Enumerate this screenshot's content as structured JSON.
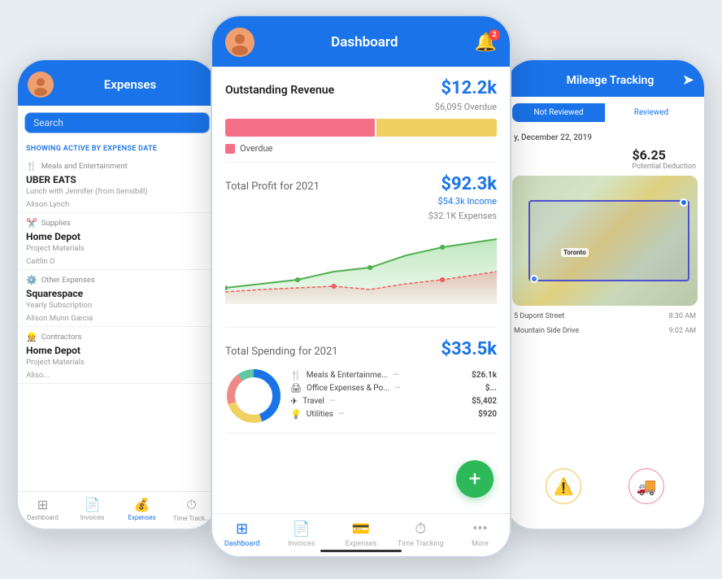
{
  "left_phone": {
    "header_title": "Expenses",
    "search_placeholder": "Search",
    "showing_label": "SHOWING",
    "showing_filter": "ACTIVE BY EXPENSE DATE",
    "groups": [
      {
        "category_icon": "🍴",
        "category": "Meals and Entertainment",
        "name": "UBER EATS",
        "sub1": "Lunch with Jennifer (from Sensibill)",
        "sub2": "Alison Lynch"
      },
      {
        "category_icon": "✂️",
        "category": "Supplies",
        "name": "Home Depot",
        "sub1": "Project Materials",
        "sub2": "Caitlin O"
      },
      {
        "category_icon": "⚙️",
        "category": "Other Expenses",
        "name": "Squarespace",
        "sub1": "Yearly Subscription",
        "sub2": "Alison Munn Garcia"
      },
      {
        "category_icon": "👷",
        "category": "Contractors",
        "name": "Home Depot",
        "sub1": "Project Materials",
        "sub2": "Aliso..."
      }
    ],
    "nav_items": [
      {
        "label": "Dashboard",
        "icon": "⊞"
      },
      {
        "label": "Invoices",
        "icon": "📄"
      },
      {
        "label": "Expenses",
        "icon": "💰",
        "active": true
      },
      {
        "label": "Time Track...",
        "icon": "⏱"
      }
    ]
  },
  "center_phone": {
    "header_title": "Dashboard",
    "notification_count": "2",
    "outstanding_revenue": {
      "title": "Outstanding Revenue",
      "amount": "$12.2k",
      "overdue_label": "$6,095 Overdue",
      "legend_label": "Overdue",
      "bar_pink_pct": 55,
      "bar_yellow_pct": 45
    },
    "total_profit": {
      "title": "Total Profit",
      "year": "for 2021",
      "amount": "$92.3k",
      "income": "$54.3k Income",
      "expenses": "$32.1K Expenses"
    },
    "total_spending": {
      "title": "Total Spending",
      "year": "for 2021",
      "amount": "$33.5k",
      "items": [
        {
          "icon": "🍴",
          "label": "Meals & Entertainme...",
          "amount": "$26.1k"
        },
        {
          "icon": "🖨",
          "label": "Office Expenses & Po...",
          "amount": "$..."
        },
        {
          "icon": "✈",
          "label": "Travel",
          "amount": "$5,402"
        },
        {
          "icon": "💡",
          "label": "Utilities",
          "amount": "$920"
        }
      ],
      "donut_segments": [
        {
          "color": "#1a73e8",
          "pct": 45
        },
        {
          "color": "#f0d060",
          "pct": 25
        },
        {
          "color": "#f47088",
          "pct": 20
        },
        {
          "color": "#60c8a0",
          "pct": 10
        }
      ]
    },
    "fab_label": "+",
    "nav_items": [
      {
        "label": "Dashboard",
        "icon": "⊞",
        "active": true
      },
      {
        "label": "Invoices",
        "icon": "📄"
      },
      {
        "label": "Expenses",
        "icon": "💳"
      },
      {
        "label": "Time Tracking",
        "icon": "⏱"
      },
      {
        "label": "More",
        "icon": "•••"
      }
    ]
  },
  "right_phone": {
    "header_title": "Mileage Tracking",
    "tabs": [
      {
        "label": "Reviewed",
        "active": true
      },
      {
        "label": "Reviewed"
      }
    ],
    "date": "y, December 22, 2019",
    "amount": "$6.25",
    "deduction": "Potential Deduction",
    "address1": "5 Dupont Street",
    "time1": "8:30 AM",
    "address2": "Mountain Side Drive",
    "time2": "9:02 AM",
    "icons": [
      {
        "type": "warning",
        "emoji": "⚠️"
      },
      {
        "type": "delivery",
        "emoji": "🚚"
      }
    ]
  }
}
